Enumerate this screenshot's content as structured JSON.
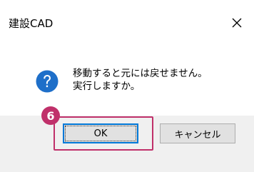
{
  "window": {
    "title": "建設CAD",
    "close_icon": "close-icon"
  },
  "message": {
    "icon": "question-icon",
    "line1": "移動すると元には戻せません。",
    "line2": "実行しますか。"
  },
  "buttons": {
    "ok_label": "OK",
    "cancel_label": "キャンセル"
  },
  "annotation": {
    "step_number": "6",
    "highlight_color": "#c0306a"
  },
  "colors": {
    "icon_blue": "#1e6fc9",
    "focus_border": "#0078d7",
    "footer_bg": "#f0f0f0"
  }
}
